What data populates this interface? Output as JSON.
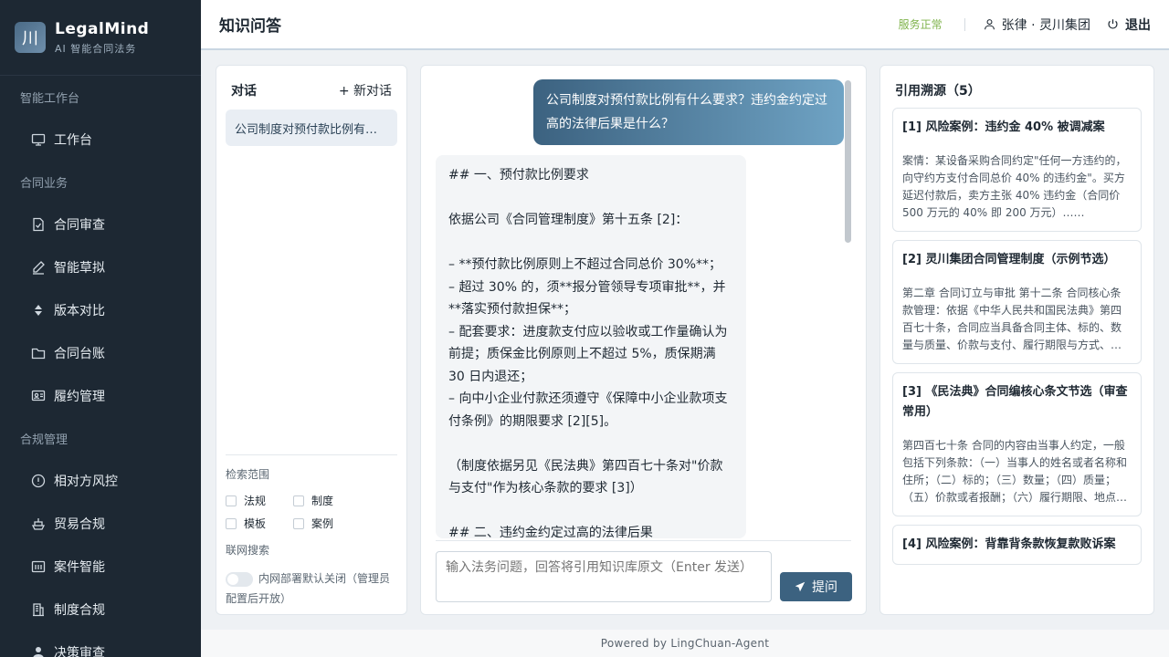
{
  "brand": {
    "logo_glyph": "川",
    "name": "LegalMind",
    "sub": "AI 智能合同法务"
  },
  "sidebar": {
    "sections": [
      {
        "title": "智能工作台",
        "items": [
          {
            "label": "工作台",
            "icon": "monitor-icon"
          }
        ]
      },
      {
        "title": "合同业务",
        "items": [
          {
            "label": "合同审查",
            "icon": "document-check-icon"
          },
          {
            "label": "智能草拟",
            "icon": "pen-icon"
          },
          {
            "label": "版本对比",
            "icon": "sort-arrows-icon"
          },
          {
            "label": "合同台账",
            "icon": "folder-icon"
          },
          {
            "label": "履约管理",
            "icon": "id-card-icon"
          }
        ]
      },
      {
        "title": "合规管理",
        "items": [
          {
            "label": "相对方风控",
            "icon": "alert-circle-icon"
          },
          {
            "label": "贸易合规",
            "icon": "ship-icon"
          },
          {
            "label": "案件智能",
            "icon": "calendar-icon"
          },
          {
            "label": "制度合规",
            "icon": "building-icon"
          },
          {
            "label": "决策审查",
            "icon": "user-icon"
          }
        ]
      }
    ]
  },
  "header": {
    "title": "知识问答",
    "status": "服务正常",
    "user": "张律 · 灵川集团",
    "logout": "退出"
  },
  "conversation": {
    "title": "对话",
    "new_label": "+ 新对话",
    "items": [
      "公司制度对预付款比例有什么要求？违约金约定过高的法律后果是什么？"
    ],
    "scope_label": "检索范围",
    "scopes": [
      "法规",
      "制度",
      "模板",
      "案例"
    ],
    "web_label": "联网搜索",
    "web_note": "内网部署默认关闭（管理员配置后开放）"
  },
  "chat": {
    "user_message": "公司制度对预付款比例有什么要求？违约金约定过高的法律后果是什么？",
    "ai_message": "## 一、预付款比例要求\n\n依据公司《合同管理制度》第十五条 [2]：\n\n– **预付款比例原则上不超过合同总价 30%**；\n– 超过 30% 的，须**报分管领导专项审批**，并**落实预付款担保**；\n– 配套要求：进度款支付应以验收或工作量确认为前提；质保金比例原则上不超过 5%，质保期满 30 日内退还；\n– 向中小企业付款还须遵守《保障中小企业款项支付条例》的期限要求 [2][5]。\n\n（制度依据另见《民法典》第四百七十条对\"价款与支付\"作为核心条款的要求 [3]）\n\n## 二、违约金约定过高的法律后果",
    "input_placeholder": "输入法务问题，回答将引用知识库原文（Enter 发送）",
    "ask_label": "提问"
  },
  "refs": {
    "title": "引用溯源（5）",
    "items": [
      {
        "title": "[1] 风险案例：违约金 40% 被调减案",
        "desc": "案情：某设备采购合同约定\"任何一方违约的，向守约方支付合同总价 40% 的违约金\"。买方延迟付款后，卖方主张 40% 违约金（合同价 500 万元的 40% 即 200 万元）……"
      },
      {
        "title": "[2] 灵川集团合同管理制度（示例节选）",
        "desc": "第二章 合同订立与审批 第十二条 合同核心条款管理：依据《中华人民共和国民法典》第四百七十条，合同应当具备合同主体、标的、数量与质量、价款与支付、履行期限与方式、违约责任……"
      },
      {
        "title": "[3] 《民法典》合同编核心条文节选（审查常用）",
        "desc": "第四百七十条 合同的内容由当事人约定，一般包括下列条款：（一）当事人的姓名或者名称和住所；（二）标的；（三）数量；（四）质量；（五）价款或者报酬；（六）履行期限、地点和方式……"
      },
      {
        "title": "[4] 风险案例：背靠背条款恢复款败诉案",
        "desc": ""
      }
    ]
  },
  "footer": "Powered by LingChuan-Agent"
}
